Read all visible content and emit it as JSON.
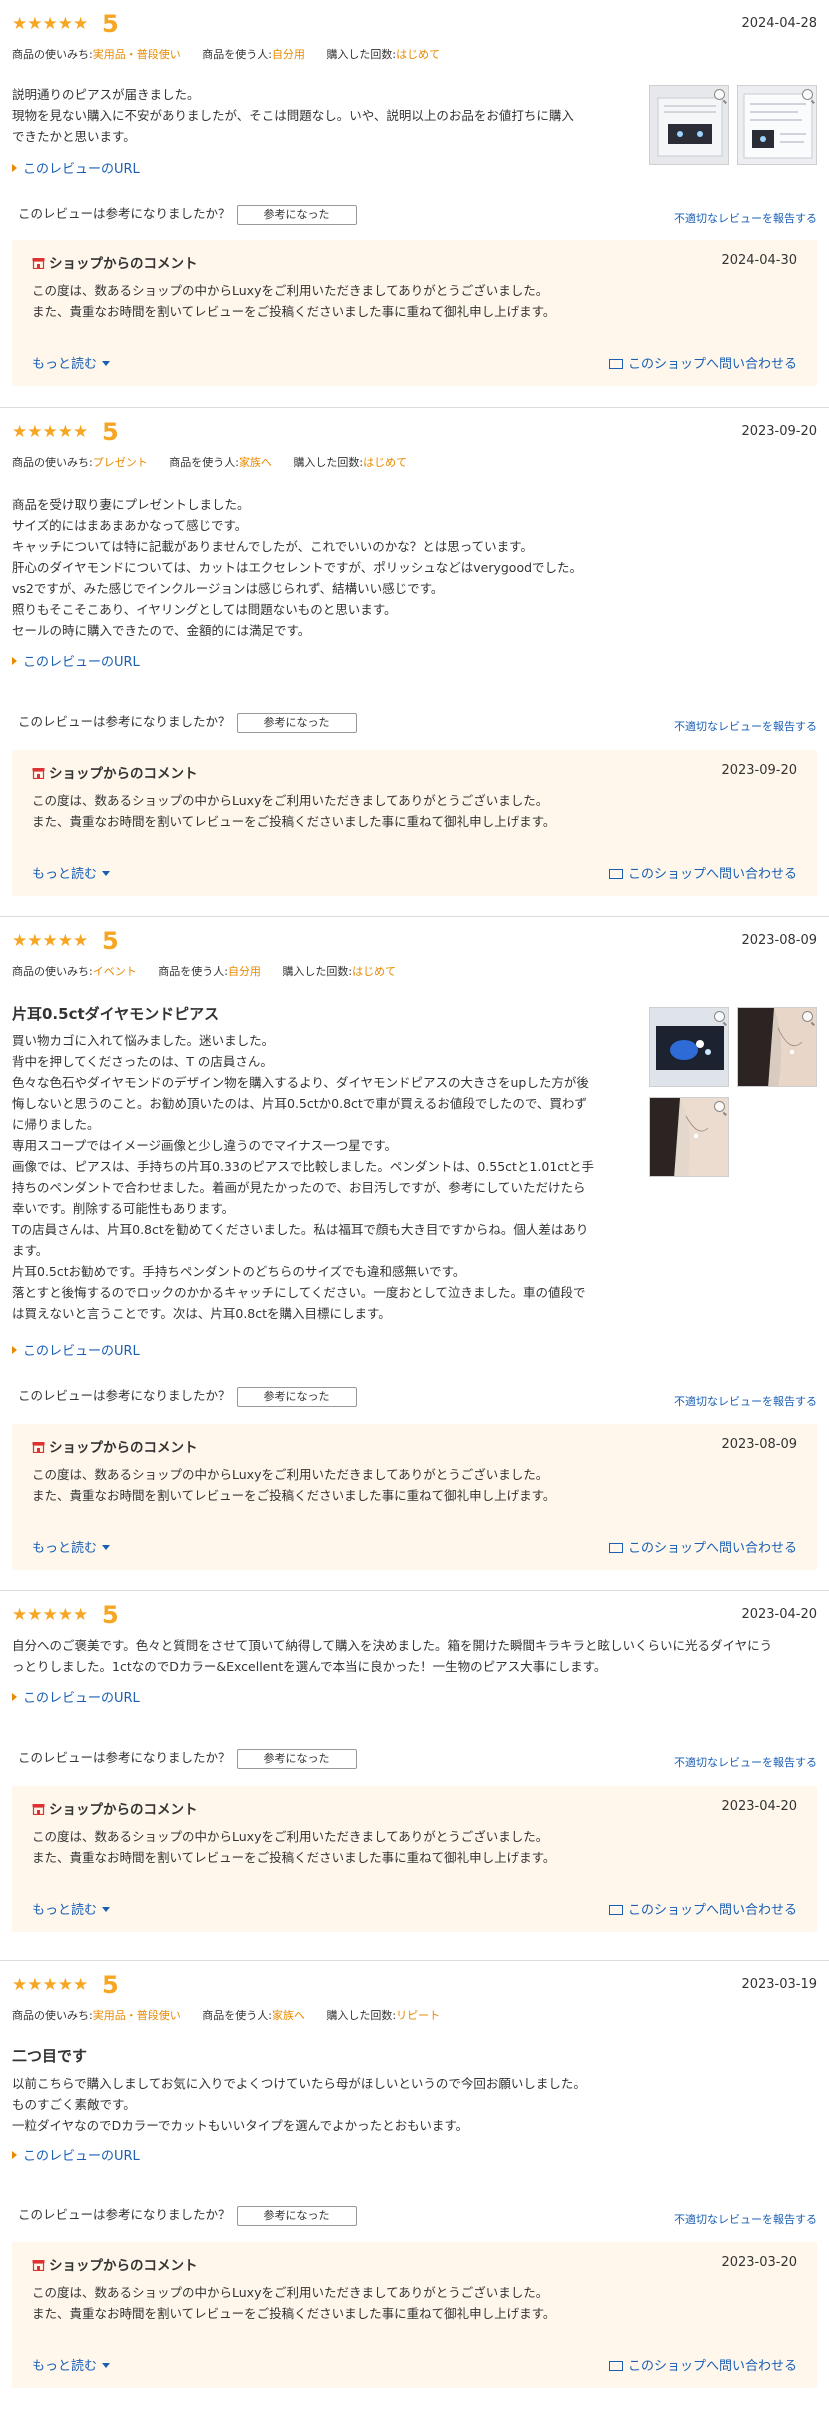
{
  "colors": {
    "star": "#f6a623",
    "accent": "#e88a00",
    "link": "#1a5fb4",
    "shop_bg": "#fff7ec"
  },
  "labels": {
    "stars": "★★★★★",
    "url": "このレビューのURL",
    "helpful_q": "このレビューは参考になりましたか？",
    "helpful_btn": "参考になった",
    "report": "不適切なレビューを報告する",
    "shop_header": "ショップからのコメント",
    "more": "もっと読む",
    "contact": "このショップへ問い合わせる",
    "use_label": "商品の使いみち:",
    "user_label": "商品を使う人:",
    "count_label": "購入した回数:"
  },
  "icons": {
    "shop": "shop-icon",
    "mail": "mail-icon",
    "zoom": "zoom-icon",
    "url_marker": "triangle-right-icon",
    "more": "chevron-down-icon"
  },
  "reviews": [
    {
      "score": "5",
      "date": "2024-04-28",
      "use": "実用品・普段使い",
      "user": "自分用",
      "count": "はじめて",
      "title": "",
      "body": "説明通りのピアスが届きました。\n現物を見ない購入に不安がありましたが、そこは問題なし。いや、説明以上のお品をお値打ちに購入\nできたかと思います。",
      "shop_date": "2024-04-30",
      "shop_body": "この度は、数あるショップの中からLuxyをご利用いただきましてありがとうございました。\nまた、貴重なお時間を割いてレビューをご投稿くださいました事に重ねて御礼申し上げます。"
    },
    {
      "score": "5",
      "date": "2023-09-20",
      "use": "プレゼント",
      "user": "家族へ",
      "count": "はじめて",
      "title": "",
      "body": "商品を受け取り妻にプレゼントしました。\nサイズ的にはまあまあかなって感じです。\nキャッチについては特に記載がありませんでしたが、これでいいのかな？とは思っています。\n肝心のダイヤモンドについては、カットはエクセレントですが、ポリッシュなどはverygoodでした。\nvs2ですが、みた感じでインクルージョンは感じられず、結構いい感じです。\n照りもそこそこあり、イヤリングとしては問題ないものと思います。\nセールの時に購入できたので、金額的には満足です。",
      "shop_date": "2023-09-20",
      "shop_body": "この度は、数あるショップの中からLuxyをご利用いただきましてありがとうございました。\nまた、貴重なお時間を割いてレビューをご投稿くださいました事に重ねて御礼申し上げます。"
    },
    {
      "score": "5",
      "date": "2023-08-09",
      "use": "イベント",
      "user": "自分用",
      "count": "はじめて",
      "title": "片耳0.5ctダイヤモンドピアス",
      "body": "買い物カゴに入れて悩みました。迷いました。\n背中を押してくださったのは、T の店員さん。\n色々な色石やダイヤモンドのデザイン物を購入するより、ダイヤモンドピアスの大きさをupした方が後\n悔しないと思うのこと。お勧め頂いたのは、片耳0.5ctか0.8ctで車が買えるお値段でしたので、買わず\nに帰りました。\n専用スコープではイメージ画像と少し違うのでマイナス一つ星です。\n画像では、ピアスは、手持ちの片耳0.33のピアスで比較しました。ペンダントは、0.55ctと1.01ctと手\n持ちのペンダントで合わせました。着画が見たかったので、お目汚しですが、参考にしていただけたら\n幸いです。削除する可能性もあります。\nTの店員さんは、片耳0.8ctを勧めてくださいました。私は福耳で顔も大き目ですからね。個人差はあり\nます。\n片耳0.5ctお勧めです。手持ちペンダントのどちらのサイズでも違和感無いです。\n落とすと後悔するのでロックのかかるキャッチにしてください。一度おとして泣きました。車の値段で\nは買えないと言うことです。次は、片耳0.8ctを購入目標にします。",
      "shop_date": "2023-08-09",
      "shop_body": "この度は、数あるショップの中からLuxyをご利用いただきましてありがとうございました。\nまた、貴重なお時間を割いてレビューをご投稿くださいました事に重ねて御礼申し上げます。"
    },
    {
      "score": "5",
      "date": "2023-04-20",
      "use": "",
      "user": "",
      "count": "",
      "title": "",
      "body": "自分へのご褒美です。色々と質問をさせて頂いて納得して購入を決めました。箱を開けた瞬間キラキラと眩しいくらいに光るダイヤにう\nっとりしました。1ctなのでDカラー&Excellentを選んで本当に良かった！一生物のピアス大事にします。",
      "shop_date": "2023-04-20",
      "shop_body": "この度は、数あるショップの中からLuxyをご利用いただきましてありがとうございました。\nまた、貴重なお時間を割いてレビューをご投稿くださいました事に重ねて御礼申し上げます。"
    },
    {
      "score": "5",
      "date": "2023-03-19",
      "use": "実用品・普段使い",
      "user": "家族へ",
      "count": "リピート",
      "title": "二つ目です",
      "body": "以前こちらで購入しましてお気に入りでよくつけていたら母がほしいというので今回お願いしました。\nものすごく素敵です。\n一粒ダイヤなのでDカラーでカットもいいタイプを選んでよかったとおもいます。",
      "shop_date": "2023-03-20",
      "shop_body": "この度は、数あるショップの中からLuxyをご利用いただきましてありがとうございました。\nまた、貴重なお時間を割いてレビューをご投稿くださいました事に重ねて御礼申し上げます。"
    }
  ]
}
